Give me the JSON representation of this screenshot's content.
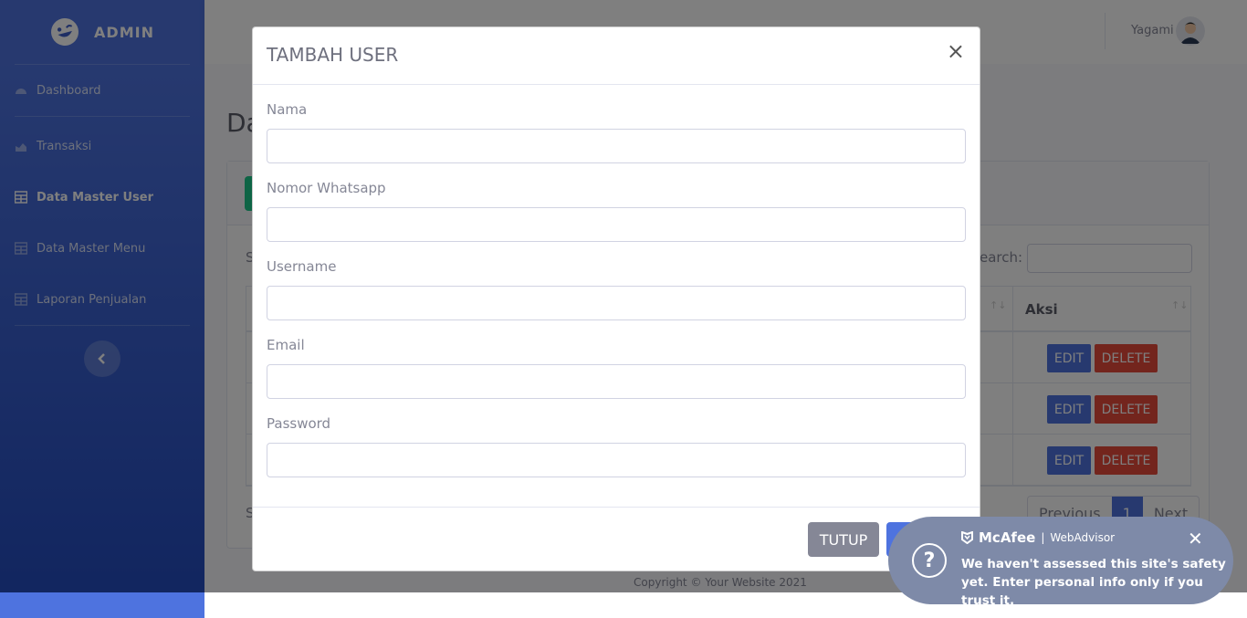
{
  "sidebar": {
    "brand": "ADMIN",
    "items": [
      {
        "label": "Dashboard",
        "icon": "tachometer-icon",
        "active": false
      },
      {
        "label": "Transaksi",
        "icon": "area-chart-icon",
        "active": false
      },
      {
        "label": "Data Master User",
        "icon": "table-icon",
        "active": true
      },
      {
        "label": "Data Master Menu",
        "icon": "table-icon",
        "active": false
      },
      {
        "label": "Laporan Penjualan",
        "icon": "table-icon",
        "active": false
      }
    ]
  },
  "topbar": {
    "username": "Yagami"
  },
  "page": {
    "title": "Da",
    "show_label": "S",
    "search_label": "earch:",
    "showing_label": "S",
    "table": {
      "aksi_header": "Aksi",
      "rows": [
        {
          "edit": "EDIT",
          "delete": "DELETE"
        },
        {
          "edit": "EDIT",
          "delete": "DELETE"
        },
        {
          "edit": "EDIT",
          "delete": "DELETE"
        }
      ]
    },
    "pagination": {
      "previous": "Previous",
      "current": "1",
      "next": "Next"
    },
    "copyright": "Copyright © Your Website 2021"
  },
  "modal": {
    "title": "TAMBAH USER",
    "close": "×",
    "fields": [
      {
        "label": "Nama",
        "value": ""
      },
      {
        "label": "Nomor Whatsapp",
        "value": ""
      },
      {
        "label": "Username",
        "value": ""
      },
      {
        "label": "Email",
        "value": ""
      },
      {
        "label": "Password",
        "value": ""
      }
    ],
    "tutup": "TUTUP"
  },
  "toast": {
    "brand": "McAfee",
    "product": "WebAdvisor",
    "message": "We haven't assessed this site's safety yet. Enter personal info only if you trust it.",
    "close": "✕"
  },
  "colors": {
    "primary": "#4e73df",
    "danger": "#e74a3b",
    "success": "#1cc88a",
    "secondary": "#858796"
  }
}
